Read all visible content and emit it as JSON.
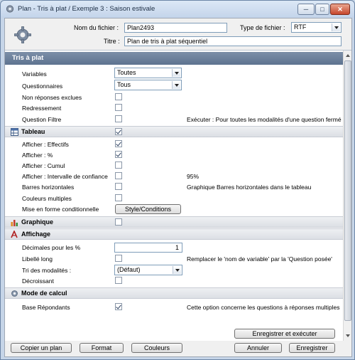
{
  "window": {
    "title": "Plan - Tris à plat / Exemple 3 : Saison estivale",
    "minimize": "─",
    "maximize": "□",
    "close": "✕"
  },
  "header": {
    "filename_label": "Nom du fichier :",
    "filename_value": "Plan2493",
    "filetype_label": "Type de fichier :",
    "filetype_value": "RTF",
    "title_label": "Titre :",
    "title_value": "Plan de tris à plat séquentiel"
  },
  "sections": {
    "tris_a_plat": {
      "title": "Tris à plat",
      "rows": {
        "variables_label": "Variables",
        "variables_value": "Toutes",
        "questionnaires_label": "Questionnaires",
        "questionnaires_value": "Tous",
        "non_reponses_label": "Non réponses exclues",
        "redressement_label": "Redressement",
        "question_filtre_label": "Question Filtre",
        "question_filtre_note": "Exécuter : Pour toutes les modalités d'une question fermé"
      }
    },
    "tableau": {
      "title": "Tableau",
      "rows": {
        "effectifs_label": "Afficher : Effectifs",
        "pct_label": "Afficher : %",
        "cumul_label": "Afficher : Cumul",
        "intervalle_label": "Afficher : Intervalle de confiance",
        "intervalle_note": "95%",
        "barres_label": "Barres horizontales",
        "barres_note": "Graphique Barres horizontales dans le tableau",
        "couleurs_label": "Couleurs multiples",
        "mise_en_forme_label": "Mise en forme conditionnelle",
        "style_button": "Style/Conditions"
      }
    },
    "graphique": {
      "title": "Graphique"
    },
    "affichage": {
      "title": "Affichage",
      "rows": {
        "decimales_label": "Décimales pour les %",
        "decimales_value": "1",
        "libelle_long_label": "Libellé long",
        "libelle_long_note": "Remplacer le 'nom de variable' par la 'Question posée'",
        "tri_modalites_label": "Tri des modalités :",
        "tri_modalites_value": "(Défaut)",
        "decroissant_label": "Décroissant"
      }
    },
    "mode_calcul": {
      "title": "Mode de calcul",
      "rows": {
        "base_label": "Base Répondants",
        "base_note": "Cette option concerne les questions à réponses multiples"
      }
    }
  },
  "footer": {
    "copier": "Copier un plan",
    "format": "Format",
    "couleurs": "Couleurs",
    "enregistrer_executer": "Enregistrer et exécuter",
    "annuler": "Annuler",
    "enregistrer": "Enregistrer"
  },
  "colors": {
    "section_blue": "#6b7f9b",
    "check_color": "#2a3e5e"
  },
  "icons": {
    "app": "gear-icon",
    "header": "gear-icon",
    "tableau": "table-icon",
    "graphique": "bar-chart-icon",
    "affichage": "text-style-icon",
    "mode_calcul": "gear-icon"
  }
}
